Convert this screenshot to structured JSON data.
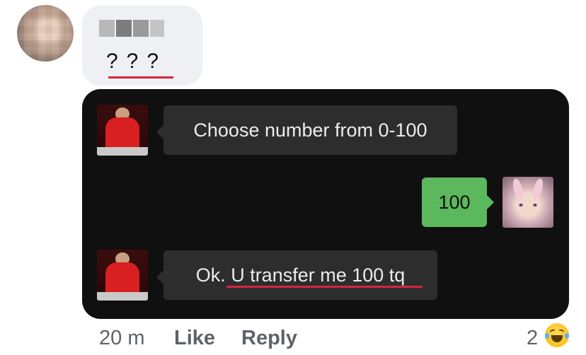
{
  "comment": {
    "author_name": "",
    "text": "???"
  },
  "chat": {
    "messages": [
      {
        "side": "left",
        "text": "Choose number from 0-100"
      },
      {
        "side": "right",
        "text": "100"
      },
      {
        "side": "left",
        "text": "Ok. U transfer me 100 tq"
      }
    ]
  },
  "actions": {
    "timestamp": "20 m",
    "like_label": "Like",
    "reply_label": "Reply",
    "reaction_count": "2",
    "reaction_icon": "laughing-emoji-icon"
  },
  "colors": {
    "underline_red": "#d6263b",
    "chat_background": "#101010",
    "sent_bubble_green": "#5cb85c",
    "received_bubble": "#2d2d2d",
    "comment_bubble": "#eef0f3"
  }
}
